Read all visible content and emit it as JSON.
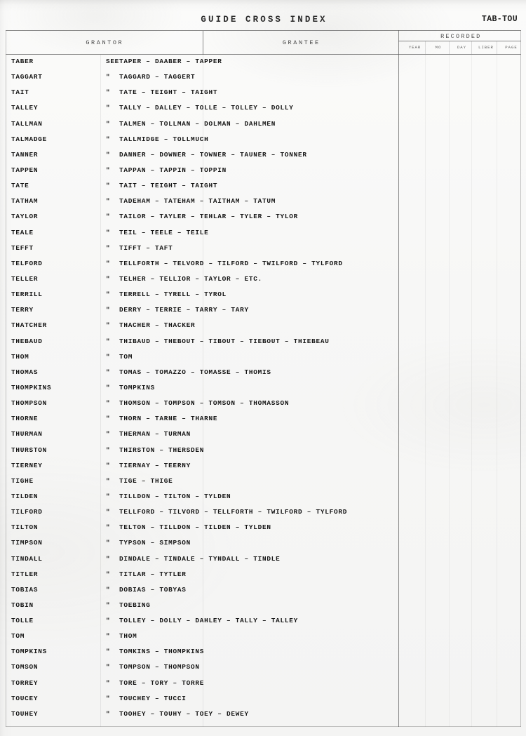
{
  "document": {
    "title": "GUIDE CROSS INDEX",
    "tab_label": "TAB-TOU"
  },
  "table": {
    "columns": {
      "grantor": "GRANTOR",
      "grantee": "GRANTEE",
      "recorded": "RECORDED",
      "recorded_sub": [
        "YEAR",
        "MO",
        "DAY",
        "LIBER",
        "PAGE"
      ]
    },
    "see_marker": "SEE",
    "ditto_marker": "\"",
    "rows": [
      {
        "grantor": "TABER",
        "marker": "SEE",
        "grantee": "TAPER – DAABER – TAPPER"
      },
      {
        "grantor": "TAGGART",
        "marker": "\"",
        "grantee": "TAGGARD – TAGGERT"
      },
      {
        "grantor": "TAIT",
        "marker": "\"",
        "grantee": "TATE – TEIGHT – TAIGHT"
      },
      {
        "grantor": "TALLEY",
        "marker": "\"",
        "grantee": "TALLY – DALLEY – TOLLE – TOLLEY – DOLLY"
      },
      {
        "grantor": "TALLMAN",
        "marker": "\"",
        "grantee": "TALMEN – TOLLMAN – DOLMAN – DAHLMEN"
      },
      {
        "grantor": "TALMADGE",
        "marker": "\"",
        "grantee": "TALLMIDGE – TOLLMUCH"
      },
      {
        "grantor": "TANNER",
        "marker": "\"",
        "grantee": "DANNER – DOWNER – TOWNER – TAUNER – TONNER"
      },
      {
        "grantor": "TAPPEN",
        "marker": "\"",
        "grantee": "TAPPAN – TAPPIN – TOPPIN"
      },
      {
        "grantor": "TATE",
        "marker": "\"",
        "grantee": "TAIT – TEIGHT – TAIGHT"
      },
      {
        "grantor": "TATHAM",
        "marker": "\"",
        "grantee": "TADEHAM – TATEHAM – TAITHAM – TATUM"
      },
      {
        "grantor": "TAYLOR",
        "marker": "\"",
        "grantee": "TAILOR – TAYLER – TEHLAR – TYLER – TYLOR"
      },
      {
        "grantor": "TEALE",
        "marker": "\"",
        "grantee": "TEIL – TEELE – TEILE"
      },
      {
        "grantor": "TEFFT",
        "marker": "\"",
        "grantee": "TIFFT – TAFT"
      },
      {
        "grantor": "TELFORD",
        "marker": "\"",
        "grantee": "TELLFORTH – TELVORD – TILFORD – TWILFORD – TYLFORD"
      },
      {
        "grantor": "TELLER",
        "marker": "\"",
        "grantee": "TELHER – TELLIOR – TAYLOR – ETC."
      },
      {
        "grantor": "TERRILL",
        "marker": "\"",
        "grantee": "TERRELL – TYRELL – TYROL"
      },
      {
        "grantor": "TERRY",
        "marker": "\"",
        "grantee": "DERRY – TERRIE – TARRY – TARY"
      },
      {
        "grantor": "THATCHER",
        "marker": "\"",
        "grantee": "THACHER – THACKER"
      },
      {
        "grantor": "THEBAUD",
        "marker": "\"",
        "grantee": "THIBAUD – THEBOUT – TIBOUT – TIEBOUT – THIEBEAU"
      },
      {
        "grantor": "THOM",
        "marker": "\"",
        "grantee": "TOM"
      },
      {
        "grantor": "THOMAS",
        "marker": "\"",
        "grantee": "TOMAS – TOMAZZO – TOMASSE – THOMIS"
      },
      {
        "grantor": "THOMPKINS",
        "marker": "\"",
        "grantee": "TOMPKINS"
      },
      {
        "grantor": "THOMPSON",
        "marker": "\"",
        "grantee": "THOMSON – TOMPSON – TOMSON – THOMASSON"
      },
      {
        "grantor": "THORNE",
        "marker": "\"",
        "grantee": "THORN – TARNE – THARNE"
      },
      {
        "grantor": "THURMAN",
        "marker": "\"",
        "grantee": "THERMAN – TURMAN"
      },
      {
        "grantor": "THURSTON",
        "marker": "\"",
        "grantee": "THIRSTON – THERSDEN"
      },
      {
        "grantor": "TIERNEY",
        "marker": "\"",
        "grantee": "TIERNAY – TEERNY"
      },
      {
        "grantor": "TIGHE",
        "marker": "\"",
        "grantee": "TIGE – THIGE"
      },
      {
        "grantor": "TILDEN",
        "marker": "\"",
        "grantee": "TILLDON – TILTON – TYLDEN"
      },
      {
        "grantor": "TILFORD",
        "marker": "\"",
        "grantee": "TELLFORD – TILVORD – TELLFORTH – TWILFORD – TYLFORD"
      },
      {
        "grantor": "TILTON",
        "marker": "\"",
        "grantee": "TELTON – TILLDON – TILDEN – TYLDEN"
      },
      {
        "grantor": "TIMPSON",
        "marker": "\"",
        "grantee": "TYPSON – SIMPSON"
      },
      {
        "grantor": "TINDALL",
        "marker": "\"",
        "grantee": "DINDALE – TINDALE – TYNDALL – TINDLE"
      },
      {
        "grantor": "TITLER",
        "marker": "\"",
        "grantee": "TITLAR – TYTLER"
      },
      {
        "grantor": "TOBIAS",
        "marker": "\"",
        "grantee": "DOBIAS – TOBYAS"
      },
      {
        "grantor": "TOBIN",
        "marker": "\"",
        "grantee": "TOEBING"
      },
      {
        "grantor": "TOLLE",
        "marker": "\"",
        "grantee": "TOLLEY – DOLLY – DAHLEY – TALLY – TALLEY"
      },
      {
        "grantor": "TOM",
        "marker": "\"",
        "grantee": "THOM"
      },
      {
        "grantor": "TOMPKINS",
        "marker": "\"",
        "grantee": "TOMKINS – THOMPKINS"
      },
      {
        "grantor": "TOMSON",
        "marker": "\"",
        "grantee": "TOMPSON – THOMPSON"
      },
      {
        "grantor": "TORREY",
        "marker": "\"",
        "grantee": "TORE – TORY – TORRE"
      },
      {
        "grantor": "TOUCEY",
        "marker": "\"",
        "grantee": "TOUCHEY – TUCCI"
      },
      {
        "grantor": "TOUHEY",
        "marker": "\"",
        "grantee": "TOOHEY – TOUHY – TOEY – DEWEY"
      }
    ]
  }
}
